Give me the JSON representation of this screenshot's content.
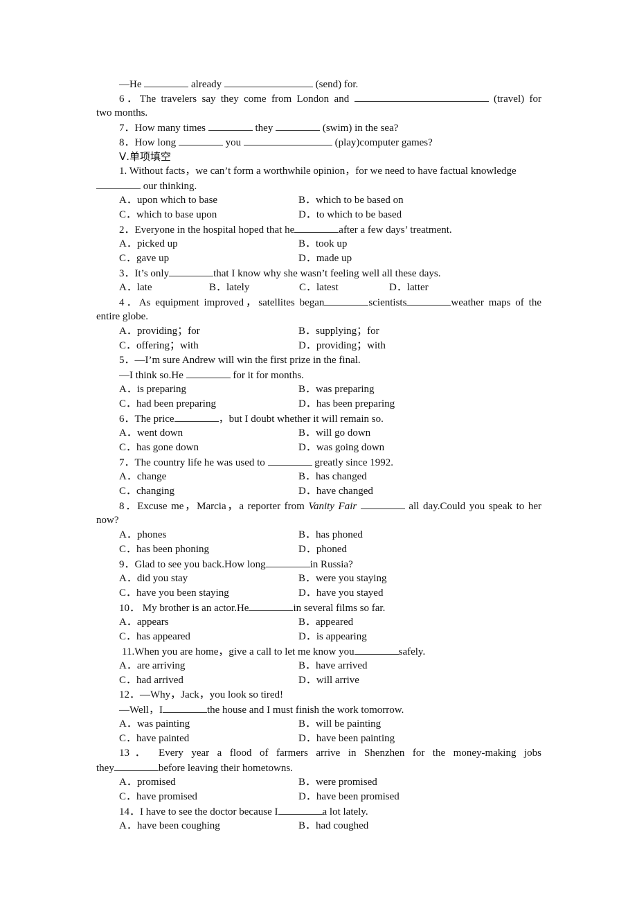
{
  "section4_tail": {
    "q5_answer": {
      "prefix": "—He ",
      "mid": " already ",
      "suffix": " (send) for."
    },
    "q6": {
      "num": "6．",
      "text": "The travelers say they come from London and ",
      "suffix": " (travel) for",
      "cont": "two months."
    },
    "q7": {
      "num": "7．",
      "text": "How many times ",
      "mid": " they ",
      "suffix": " (swim) in the sea?"
    },
    "q8": {
      "num": "8．",
      "text": "How long ",
      "mid": " you ",
      "suffix": " (play)computer games?"
    }
  },
  "section5": {
    "heading": "Ⅴ.单项填空",
    "questions": [
      {
        "stem": "1. Without facts，we can’t form a worthwhile opinion，for we need to have factual knowledge",
        "cont_suffix": " our thinking.",
        "options": [
          "A．upon which to base",
          "B．which to be based on",
          "C．which to base upon",
          "D．to which to be based"
        ]
      },
      {
        "stem_pre": "2．Everyone in the hospital hoped that he",
        "stem_post": "after a few days’ treatment.",
        "options": [
          "A．picked up",
          "B．took up",
          "C．gave up",
          "D．made up"
        ]
      },
      {
        "stem_pre": "3．It’s only",
        "stem_post": "that I know why she wasn’t feeling well all these days.",
        "options": [
          "A．late",
          "B．lately",
          "C．latest",
          "D．latter"
        ]
      },
      {
        "stem_pre": "4．As equipment improved，satellites began",
        "stem_mid": "scientists",
        "stem_post": "weather maps of the",
        "cont": "entire globe.",
        "options": [
          "A．providing；for",
          "B．supplying；for",
          "C．offering；with",
          "D．providing；with"
        ]
      },
      {
        "stem": "5．—I’m sure Andrew will win the first prize in the final.",
        "line2_pre": "—I think so.He ",
        "line2_post": " for it for months.",
        "options": [
          "A．is preparing",
          "B．was preparing",
          "C．had been preparing",
          "D．has been preparing"
        ]
      },
      {
        "stem_pre": "6．The price",
        "stem_post": "，but I doubt whether it will remain so.",
        "options": [
          "A．went down",
          "B．will go down",
          "C．has gone down",
          "D．was going down"
        ]
      },
      {
        "stem_pre": "7．The country life he was used to ",
        "stem_post": " greatly since 1992.",
        "options": [
          "A．change",
          "B．has changed",
          "C．changing",
          "D．have changed"
        ]
      },
      {
        "stem_pre": "8．Excuse me，Marcia，a reporter from ",
        "italic": "Vanity Fair",
        "stem_post": " all day.Could you speak to her",
        "cont": "now?",
        "options": [
          "A．phones",
          "B．has phoned",
          "C．has been phoning",
          "D．phoned"
        ]
      },
      {
        "stem_pre": "9．Glad to see you back.How long",
        "stem_post": "in Russia?",
        "options": [
          "A．did you stay",
          "B．were you staying",
          "C．have you been staying",
          "D．have you stayed"
        ]
      },
      {
        "stem_pre": "10． My brother is an actor.He",
        "stem_post": "in several films so far.",
        "options": [
          "A．appears",
          "B．appeared",
          "C．has appeared",
          "D．is appearing"
        ]
      },
      {
        "stem_pre": "11.When you are home，give a call to let me know you",
        "stem_post": "safely.",
        "options": [
          "A．are arriving",
          "B．have arrived",
          "C．had arrived",
          "D．will arrive"
        ]
      },
      {
        "stem": "12．—Why，Jack，you look so tired!",
        "line2_pre": "—Well，I",
        "line2_post": "the house and I must finish the work tomorrow.",
        "options": [
          "A．was painting",
          "B．will be painting",
          "C．have painted",
          "D．have been painting"
        ]
      },
      {
        "stem": "13． Every year a flood of farmers arrive in Shenzhen for the money-making jobs",
        "cont_pre": "they",
        "cont_post": "before leaving their hometowns.",
        "options": [
          "A．promised",
          "B．were promised",
          "C．have promised",
          "D．have been promised"
        ]
      },
      {
        "stem_pre": "14．I have to see the doctor because I",
        "stem_post": "a lot lately.",
        "options": [
          "A．have been coughing",
          "B．had coughed"
        ]
      }
    ]
  }
}
